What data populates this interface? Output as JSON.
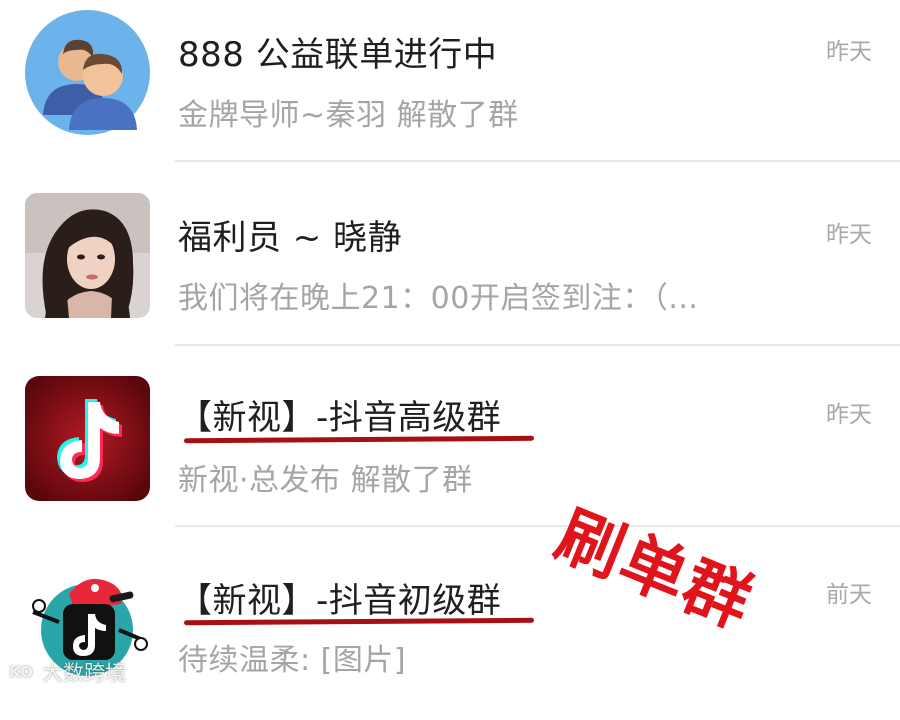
{
  "chats": [
    {
      "title": "888 公益联单进行中",
      "preview": "金牌导师~秦羽 解散了群",
      "time": "昨天",
      "avatar_icon": "group-users-icon"
    },
    {
      "title": "福利员 ~ 晓静",
      "preview": "我们将在晚上21：00开启签到注：（...",
      "time": "昨天",
      "avatar_icon": "user-photo-avatar"
    },
    {
      "title": "【新视】-抖音高级群",
      "preview": "新视·总发布 解散了群",
      "time": "昨天",
      "avatar_icon": "tiktok-logo-icon"
    },
    {
      "title": "【新视】-抖音初级群",
      "preview": "待续温柔: [图片]",
      "time": "前天",
      "avatar_icon": "tiktok-cartoon-icon"
    }
  ],
  "annotation": {
    "stamp_text": "刷单群",
    "stamp_color": "#e0141b",
    "underline_color": "#a80f14"
  },
  "watermark": {
    "logo_text": "KO",
    "text": "大数跨境"
  }
}
